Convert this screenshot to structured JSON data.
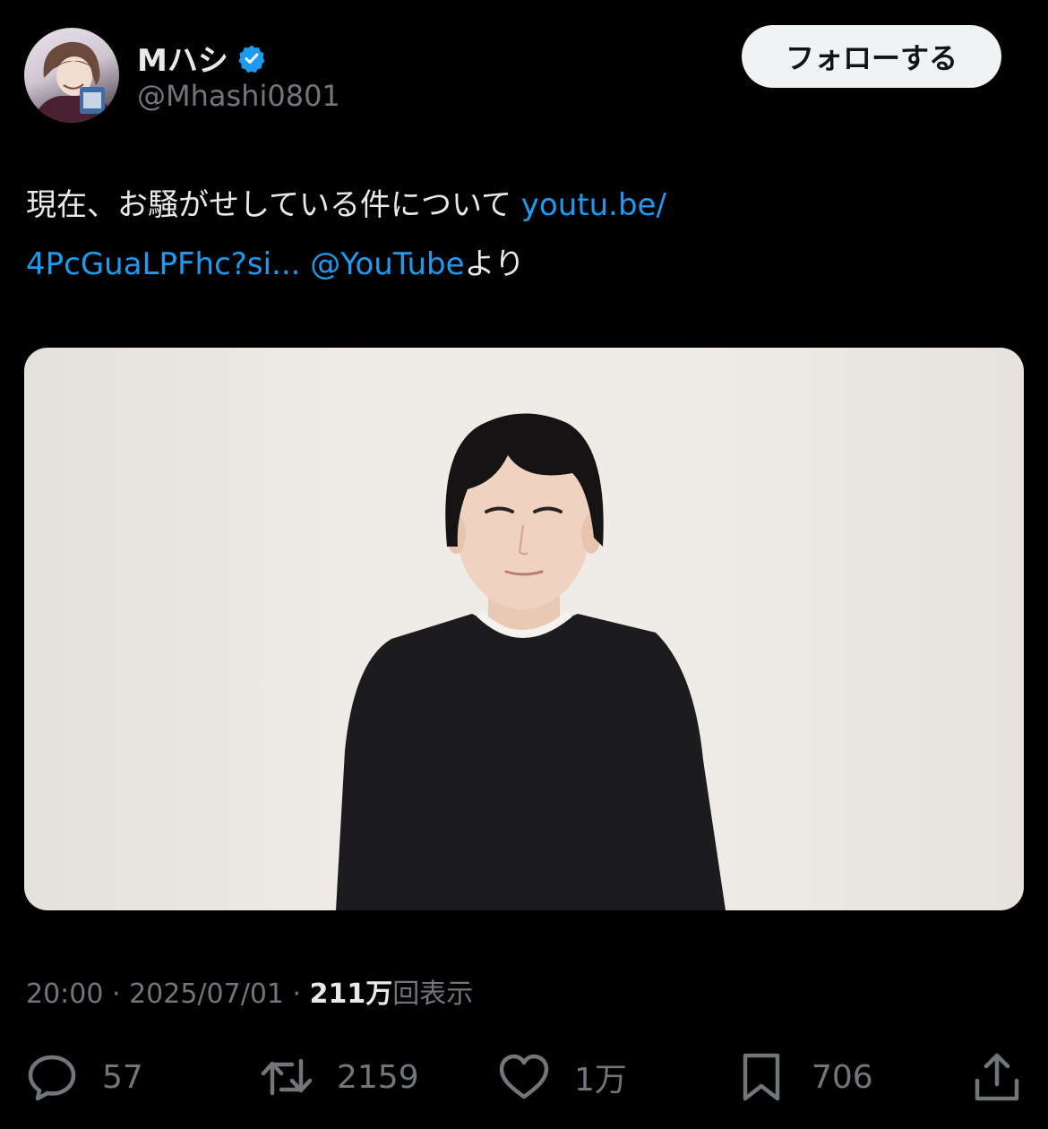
{
  "author": {
    "display_name": "Mハシ",
    "handle": "@Mhashi0801",
    "verified": true,
    "avatar_icon": "avatar-image"
  },
  "follow_button": {
    "label": "フォローする"
  },
  "tweet": {
    "text_main": "現在、お騒がせしている件について ",
    "link_1": "youtu.be/",
    "link_2": "4PcGuaLPFhc?si...",
    "mention": "@YouTube",
    "text_suffix": "より"
  },
  "media": {
    "type": "video-thumbnail"
  },
  "meta": {
    "time": "20:00",
    "sep": " · ",
    "date": "2025/07/01",
    "views_count": "211万",
    "views_label": "回表示"
  },
  "actions": {
    "reply": {
      "icon": "reply-icon",
      "count": "57"
    },
    "repost": {
      "icon": "repost-icon",
      "count": "2159"
    },
    "like": {
      "icon": "heart-icon",
      "count": "1万"
    },
    "bookmark": {
      "icon": "bookmark-icon",
      "count": "706"
    },
    "share": {
      "icon": "share-icon"
    }
  },
  "colors": {
    "background": "#000000",
    "text": "#e7e9ea",
    "muted": "#71767b",
    "link": "#1d9bf0",
    "verified": "#1d9bf0"
  }
}
